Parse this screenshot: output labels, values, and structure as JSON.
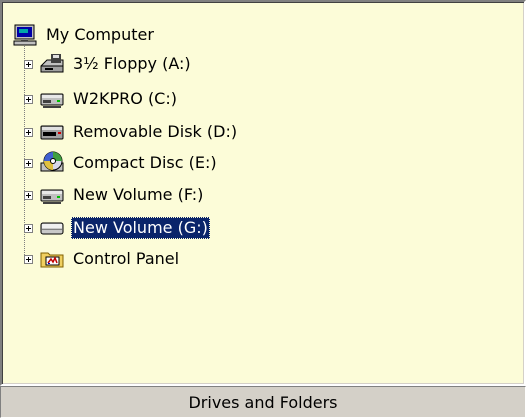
{
  "tree": {
    "root": {
      "label": "My Computer",
      "icon": "computer-icon"
    },
    "items": [
      {
        "label": "3½ Floppy (A:)",
        "icon": "floppy-drive-icon"
      },
      {
        "label": "W2KPRO (C:)",
        "icon": "hard-drive-icon"
      },
      {
        "label": "Removable Disk (D:)",
        "icon": "removable-disk-icon"
      },
      {
        "label": "Compact Disc (E:)",
        "icon": "cd-drive-icon"
      },
      {
        "label": "New Volume (F:)",
        "icon": "hard-drive-icon"
      },
      {
        "label": "New Volume (G:)",
        "icon": "drive-icon",
        "selected": true
      },
      {
        "label": "Control Panel",
        "icon": "control-panel-icon"
      }
    ]
  },
  "status_bar": {
    "text": "Drives and Folders"
  },
  "colors": {
    "panel_background": "#fcfcd8",
    "selection_background": "#0a246a",
    "selection_text": "#ffffff",
    "chrome": "#d4d0c8"
  }
}
